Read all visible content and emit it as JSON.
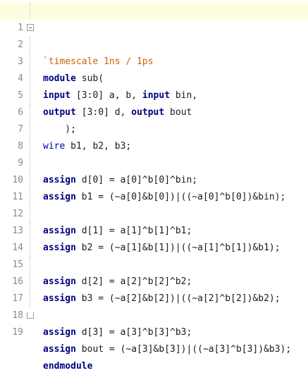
{
  "colors": {
    "keyword": "#00007f",
    "directive": "#c86400",
    "type": "#0000a8",
    "text": "#1a1a1a",
    "line_number": "#8a8a8a",
    "current_line": "#fffde0"
  },
  "lines": [
    {
      "num": "1",
      "seg": [
        "`timescale 1ns / 1ps"
      ]
    },
    {
      "num": "2",
      "seg": [
        "module",
        " sub("
      ]
    },
    {
      "num": "3",
      "seg": [
        "input",
        " [3:0] a, b, ",
        "input",
        " bin,"
      ]
    },
    {
      "num": "4",
      "seg": [
        "output",
        " [3:0] d, ",
        "output",
        " bout"
      ]
    },
    {
      "num": "5",
      "seg": [
        "    );"
      ]
    },
    {
      "num": "6",
      "seg": [
        "wire",
        " b1, b2, b3;"
      ]
    },
    {
      "num": "7",
      "seg": []
    },
    {
      "num": "8",
      "seg": [
        "assign",
        " d[0] = a[0]^b[0]^bin;"
      ]
    },
    {
      "num": "9",
      "seg": [
        "assign",
        " b1 = (~a[0]&b[0])|((~a[0]^b[0])&bin);"
      ]
    },
    {
      "num": "10",
      "seg": []
    },
    {
      "num": "11",
      "seg": [
        "assign",
        " d[1] = a[1]^b[1]^b1;"
      ]
    },
    {
      "num": "12",
      "seg": [
        "assign",
        " b2 = (~a[1]&b[1])|((~a[1]^b[1])&b1);"
      ]
    },
    {
      "num": "13",
      "seg": []
    },
    {
      "num": "14",
      "seg": [
        "assign",
        " d[2] = a[2]^b[2]^b2;"
      ]
    },
    {
      "num": "15",
      "seg": [
        "assign",
        " b3 = (~a[2]&b[2])|((~a[2]^b[2])&b2);"
      ]
    },
    {
      "num": "16",
      "seg": []
    },
    {
      "num": "17",
      "seg": [
        "assign",
        " d[3] = a[3]^b[3]^b3;"
      ]
    },
    {
      "num": "18",
      "seg": [
        "assign",
        " bout = (~a[3]&b[3])|((~a[3]^b[3])&b3);"
      ]
    },
    {
      "num": "19",
      "seg": [
        "endmodule"
      ]
    }
  ]
}
